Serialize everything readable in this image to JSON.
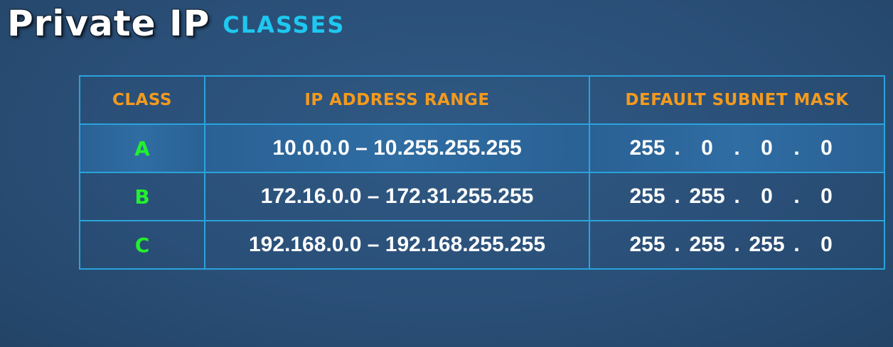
{
  "title": {
    "main": "Private IP",
    "sub": "CLASSES"
  },
  "table": {
    "headers": [
      "CLASS",
      "IP ADDRESS RANGE",
      "DEFAULT SUBNET MASK"
    ],
    "rows": [
      {
        "class": "A",
        "range": "10.0.0.0 – 10.255.255.255",
        "mask": [
          "255",
          "0",
          "0",
          "0"
        ]
      },
      {
        "class": "B",
        "range": "172.16.0.0 – 172.31.255.255",
        "mask": [
          "255",
          "255",
          "0",
          "0"
        ]
      },
      {
        "class": "C",
        "range": "192.168.0.0 – 192.168.255.255",
        "mask": [
          "255",
          "255",
          "255",
          "0"
        ]
      }
    ],
    "mask_separator": ".",
    "highlighted_row": 0
  },
  "colors": {
    "header_text": "#f39a1e",
    "class_text": "#23f02c",
    "border": "#2aa3dc",
    "subtitle": "#1ec8f0",
    "background": "#2a4f78"
  }
}
